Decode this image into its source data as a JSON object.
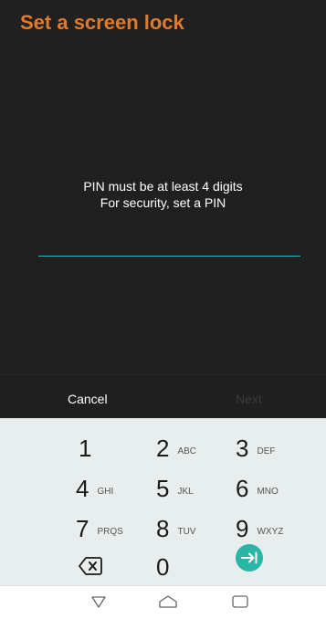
{
  "header": {
    "title": "Set a screen lock"
  },
  "messages": {
    "line1": "PIN must be at least 4 digits",
    "line2": "For security, set a PIN"
  },
  "pin_input": {
    "value": ""
  },
  "actions": {
    "cancel_label": "Cancel",
    "next_label": "Next"
  },
  "keypad": {
    "keys": [
      {
        "digit": "1",
        "letters": ""
      },
      {
        "digit": "2",
        "letters": "ABC"
      },
      {
        "digit": "3",
        "letters": "DEF"
      },
      {
        "digit": "4",
        "letters": "GHI"
      },
      {
        "digit": "5",
        "letters": "JKL"
      },
      {
        "digit": "6",
        "letters": "MNO"
      },
      {
        "digit": "7",
        "letters": "PRQS"
      },
      {
        "digit": "8",
        "letters": "TUV"
      },
      {
        "digit": "9",
        "letters": "WXYZ"
      },
      {
        "digit": "0",
        "letters": ""
      }
    ],
    "backspace_icon": "backspace-icon",
    "enter_icon": "enter-next-icon"
  },
  "navigation": {
    "back_icon": "back-icon",
    "home_icon": "home-icon",
    "recents_icon": "recents-icon"
  },
  "colors": {
    "accent_title": "#e07a2c",
    "input_underline": "#2fb6c6",
    "enter_button": "#2bb5a6",
    "keyboard_bg": "#e8eeee"
  }
}
